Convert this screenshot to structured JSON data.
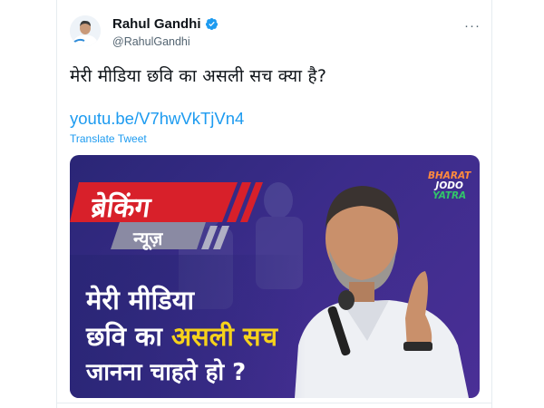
{
  "author": {
    "name": "Rahul Gandhi",
    "handle": "@RahulGandhi"
  },
  "tweet": {
    "text": "मेरी मीडिया छवि का असली सच क्या है?",
    "link": "youtu.be/V7hwVkTjVn4",
    "translate_label": "Translate Tweet",
    "more_label": "···"
  },
  "card": {
    "badge_top": "ब्रेकिंग",
    "badge_bottom": "न्यूज़",
    "line1": "मेरी मीडिया",
    "line2_prefix": "छवि का",
    "line2_accent": "असली सच",
    "line3": "जानना चाहते हो ?",
    "brand_line1": "BHARAT",
    "brand_line2": "JODO",
    "brand_line3": "YATRA"
  },
  "colors": {
    "link": "#1d9bf0",
    "verified": "#1d9bf0",
    "card_bg": "#3b2c8a",
    "accent": "#f6d21b",
    "banner_red": "#d8202a"
  }
}
